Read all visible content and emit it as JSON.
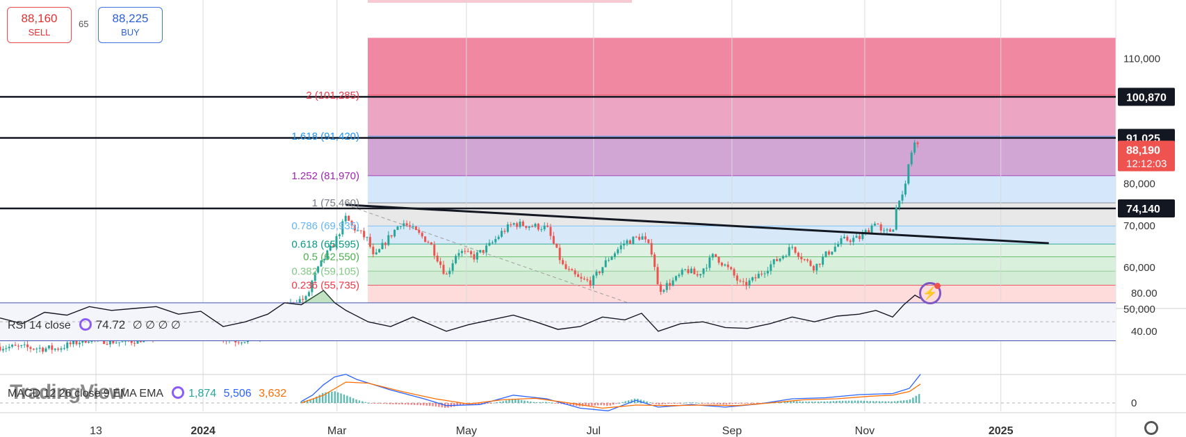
{
  "quote": {
    "sell_price": "88,160",
    "sell_label": "SELL",
    "spread": "65",
    "buy_price": "88,225",
    "buy_label": "BUY"
  },
  "rsi_legend": {
    "name": "RSI 14 close",
    "value": "74.72",
    "extra": "∅ ∅ ∅ ∅"
  },
  "macd_legend": {
    "name": "MACD 12 26 close 9 EMA EMA",
    "macd": "1,874",
    "signal": "5,506",
    "hist": "3,632"
  },
  "watermark": "TradingView",
  "colors": {
    "up": "#26a69a",
    "down": "#ef5350",
    "rsi_band": "#3f51b5",
    "macd_line": "#2962ff",
    "signal_line": "#ff6d00"
  },
  "chart_data": [
    {
      "type": "candlestick",
      "title": "",
      "x_ticks": [
        "13",
        "2024",
        "Mar",
        "May",
        "Jul",
        "Sep",
        "Nov",
        "2025"
      ],
      "y_ticks": [
        "110,000",
        "80,000",
        "70,000",
        "60,000",
        "50,000"
      ],
      "ylim": [
        42000,
        115000
      ],
      "price_labels": [
        {
          "label": "100,870",
          "value": 100870,
          "style": "dark"
        },
        {
          "label": "91,025",
          "value": 91025,
          "style": "dark"
        },
        {
          "label": "88,190",
          "sub": "12:12:03",
          "value": 88190,
          "style": "red"
        },
        {
          "label": "74,140",
          "value": 74140,
          "style": "dark"
        }
      ],
      "horizontal_lines": [
        100870,
        91025,
        74140
      ],
      "fibonacci": [
        {
          "level": "2",
          "price": "101,285",
          "value": 101285,
          "text_color": "#f23645"
        },
        {
          "level": "1.618",
          "price": "91,420",
          "value": 91420,
          "text_color": "#2196f3"
        },
        {
          "level": "1.252",
          "price": "81,970",
          "value": 81970,
          "text_color": "#9c27b0"
        },
        {
          "level": "1",
          "price": "75,460",
          "value": 75460,
          "text_color": "#787b86"
        },
        {
          "level": "0.786",
          "price": "69,935",
          "value": 69935,
          "text_color": "#64b5f6"
        },
        {
          "level": "0.618",
          "price": "65,595",
          "value": 65595,
          "text_color": "#089981"
        },
        {
          "level": "0.5",
          "price": "62,550",
          "value": 62550,
          "text_color": "#4caf50"
        },
        {
          "level": "0.382",
          "price": "59,105",
          "value": 59105,
          "text_color": "#81c784"
        },
        {
          "level": "0.236",
          "price": "55,735",
          "value": 55735,
          "text_color": "#f23645"
        }
      ],
      "price_path": [
        [
          0,
          41000
        ],
        [
          0.05,
          40500
        ],
        [
          0.08,
          43000
        ],
        [
          0.11,
          42000
        ],
        [
          0.14,
          43500
        ],
        [
          0.165,
          44500
        ],
        [
          0.18,
          47000
        ],
        [
          0.19,
          44000
        ],
        [
          0.21,
          42500
        ],
        [
          0.23,
          43000
        ],
        [
          0.245,
          46000
        ],
        [
          0.255,
          50000
        ],
        [
          0.265,
          52000
        ],
        [
          0.275,
          52500
        ],
        [
          0.28,
          57000
        ],
        [
          0.29,
          62000
        ],
        [
          0.3,
          66000
        ],
        [
          0.31,
          72000
        ],
        [
          0.315,
          70000
        ],
        [
          0.33,
          66500
        ],
        [
          0.335,
          62000
        ],
        [
          0.345,
          66000
        ],
        [
          0.36,
          71000
        ],
        [
          0.375,
          68000
        ],
        [
          0.385,
          66000
        ],
        [
          0.4,
          58000
        ],
        [
          0.41,
          64000
        ],
        [
          0.425,
          62500
        ],
        [
          0.44,
          65500
        ],
        [
          0.45,
          68500
        ],
        [
          0.46,
          70500
        ],
        [
          0.475,
          70000
        ],
        [
          0.49,
          69500
        ],
        [
          0.505,
          60000
        ],
        [
          0.52,
          57000
        ],
        [
          0.53,
          56500
        ],
        [
          0.545,
          62000
        ],
        [
          0.56,
          66000
        ],
        [
          0.575,
          67500
        ],
        [
          0.585,
          63500
        ],
        [
          0.59,
          54500
        ],
        [
          0.605,
          57000
        ],
        [
          0.615,
          59500
        ],
        [
          0.625,
          58000
        ],
        [
          0.64,
          63000
        ],
        [
          0.655,
          59000
        ],
        [
          0.665,
          55500
        ],
        [
          0.675,
          57000
        ],
        [
          0.69,
          60500
        ],
        [
          0.7,
          62500
        ],
        [
          0.71,
          65000
        ],
        [
          0.72,
          62000
        ],
        [
          0.73,
          60000
        ],
        [
          0.74,
          63000
        ],
        [
          0.755,
          66500
        ],
        [
          0.77,
          67000
        ],
        [
          0.78,
          69500
        ],
        [
          0.785,
          71500
        ],
        [
          0.79,
          68000
        ],
        [
          0.8,
          69000
        ],
        [
          0.805,
          77000
        ],
        [
          0.81,
          76500
        ],
        [
          0.815,
          86000
        ],
        [
          0.82,
          90000
        ],
        [
          0.825,
          88190
        ]
      ],
      "trendline": {
        "from": [
          0.31,
          75000
        ],
        "to": [
          0.94,
          65800
        ]
      },
      "dashed_line": {
        "from": [
          0.31,
          75000
        ],
        "to": [
          0.59,
          49000
        ]
      }
    },
    {
      "type": "line",
      "title": "",
      "y_ticks": [
        "80.00",
        "40.00"
      ],
      "ylim": [
        10,
        95
      ],
      "bands": [
        70,
        30
      ],
      "mid": 50,
      "path": [
        [
          0,
          54
        ],
        [
          0.02,
          48
        ],
        [
          0.04,
          60
        ],
        [
          0.06,
          57
        ],
        [
          0.08,
          66
        ],
        [
          0.1,
          62
        ],
        [
          0.12,
          64
        ],
        [
          0.14,
          66
        ],
        [
          0.16,
          58
        ],
        [
          0.18,
          61
        ],
        [
          0.2,
          45
        ],
        [
          0.22,
          50
        ],
        [
          0.24,
          58
        ],
        [
          0.255,
          70
        ],
        [
          0.27,
          68
        ],
        [
          0.29,
          83
        ],
        [
          0.3,
          70
        ],
        [
          0.31,
          62
        ],
        [
          0.33,
          50
        ],
        [
          0.35,
          45
        ],
        [
          0.37,
          55
        ],
        [
          0.39,
          45
        ],
        [
          0.4,
          40
        ],
        [
          0.42,
          47
        ],
        [
          0.44,
          52
        ],
        [
          0.46,
          57
        ],
        [
          0.48,
          50
        ],
        [
          0.5,
          42
        ],
        [
          0.52,
          45
        ],
        [
          0.54,
          55
        ],
        [
          0.56,
          52
        ],
        [
          0.575,
          59
        ],
        [
          0.59,
          40
        ],
        [
          0.61,
          48
        ],
        [
          0.63,
          50
        ],
        [
          0.65,
          44
        ],
        [
          0.67,
          43
        ],
        [
          0.69,
          48
        ],
        [
          0.71,
          55
        ],
        [
          0.73,
          50
        ],
        [
          0.75,
          56
        ],
        [
          0.77,
          58
        ],
        [
          0.785,
          62
        ],
        [
          0.8,
          55
        ],
        [
          0.81,
          68
        ],
        [
          0.82,
          78
        ],
        [
          0.825,
          74.72
        ]
      ]
    },
    {
      "type": "line",
      "title": "",
      "y_ticks": [
        "0"
      ],
      "ylim": [
        -4000,
        8000
      ],
      "macd_path": [
        [
          0.27,
          300
        ],
        [
          0.28,
          1500
        ],
        [
          0.29,
          3500
        ],
        [
          0.3,
          5000
        ],
        [
          0.31,
          5500
        ],
        [
          0.32,
          4500
        ],
        [
          0.35,
          2500
        ],
        [
          0.38,
          800
        ],
        [
          0.4,
          -500
        ],
        [
          0.43,
          -300
        ],
        [
          0.46,
          1500
        ],
        [
          0.49,
          800
        ],
        [
          0.52,
          -1000
        ],
        [
          0.545,
          -1500
        ],
        [
          0.57,
          500
        ],
        [
          0.59,
          -800
        ],
        [
          0.62,
          -300
        ],
        [
          0.65,
          -800
        ],
        [
          0.68,
          -200
        ],
        [
          0.71,
          800
        ],
        [
          0.74,
          1000
        ],
        [
          0.77,
          1600
        ],
        [
          0.8,
          1800
        ],
        [
          0.815,
          2800
        ],
        [
          0.825,
          5506
        ]
      ],
      "signal_path": [
        [
          0.27,
          0
        ],
        [
          0.29,
          1500
        ],
        [
          0.31,
          4000
        ],
        [
          0.33,
          3800
        ],
        [
          0.36,
          2200
        ],
        [
          0.39,
          800
        ],
        [
          0.42,
          -200
        ],
        [
          0.45,
          600
        ],
        [
          0.48,
          900
        ],
        [
          0.51,
          0
        ],
        [
          0.54,
          -1000
        ],
        [
          0.57,
          -400
        ],
        [
          0.6,
          -500
        ],
        [
          0.63,
          -400
        ],
        [
          0.66,
          -500
        ],
        [
          0.69,
          0
        ],
        [
          0.72,
          600
        ],
        [
          0.75,
          800
        ],
        [
          0.78,
          1300
        ],
        [
          0.8,
          1500
        ],
        [
          0.815,
          2200
        ],
        [
          0.825,
          3632
        ]
      ]
    }
  ]
}
